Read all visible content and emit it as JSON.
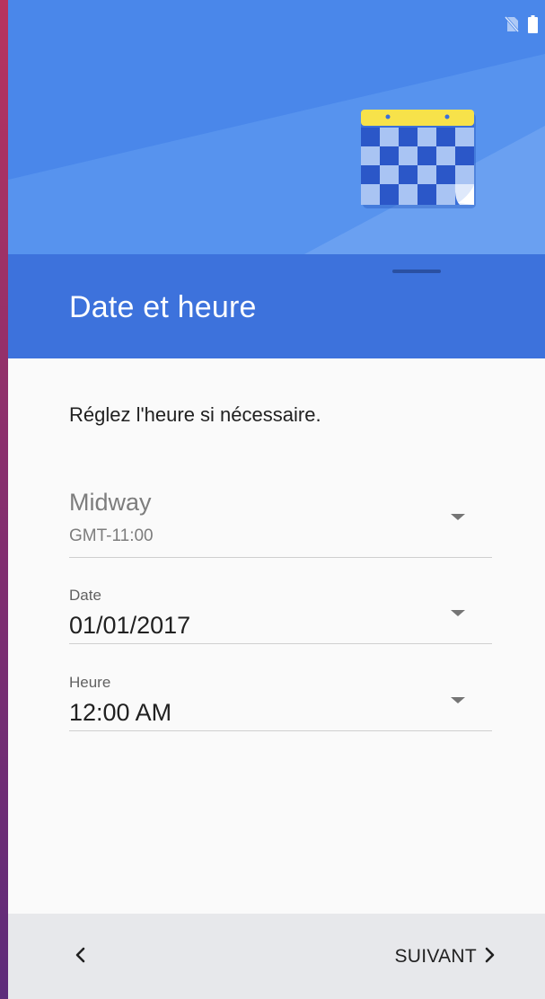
{
  "status_bar": {
    "icons": [
      "no-sim-icon",
      "battery-icon"
    ]
  },
  "hero": {
    "illustration": "calendar-icon",
    "colors": {
      "background": "#4a87ea",
      "calendar_top": "#f7e24a",
      "calendar_checks_dark": "#2b57c8",
      "calendar_checks_light": "#a9c4f3"
    }
  },
  "header": {
    "title": "Date et heure",
    "color": "#3d72dc"
  },
  "main": {
    "instruction": "Réglez l'heure si nécessaire.",
    "timezone": {
      "name": "Midway",
      "offset": "GMT-11:00"
    },
    "date": {
      "label": "Date",
      "value": "01/01/2017"
    },
    "time": {
      "label": "Heure",
      "value": "12:00 AM"
    }
  },
  "footer": {
    "back_icon": "chevron-left-icon",
    "next_label": "SUIVANT",
    "next_icon": "chevron-right-icon"
  }
}
